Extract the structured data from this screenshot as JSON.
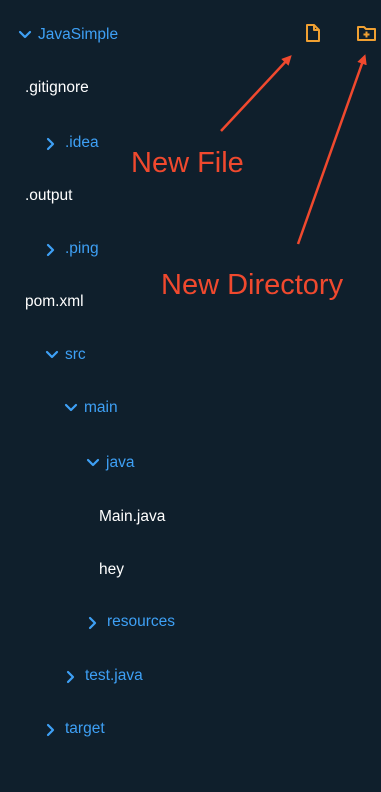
{
  "explorer": {
    "root_label": "JavaSimple",
    "items": [
      {
        "label": ".gitignore"
      },
      {
        "label": ".idea"
      },
      {
        "label": ".output"
      },
      {
        "label": ".ping"
      },
      {
        "label": "pom.xml"
      },
      {
        "label": "src"
      },
      {
        "label": "main"
      },
      {
        "label": "java"
      },
      {
        "label": "Main.java"
      },
      {
        "label": "hey"
      },
      {
        "label": "resources"
      },
      {
        "label": "test.java"
      },
      {
        "label": "target"
      }
    ]
  },
  "toolbar": {
    "new_file_icon": "new-file-icon",
    "new_folder_icon": "new-folder-icon",
    "accent_color": "#f0a032"
  },
  "annotations": {
    "new_file": "New File",
    "new_directory": "New Directory",
    "color": "#f0492e"
  },
  "colors": {
    "background": "#0f1f2c",
    "folder_text": "#3ea0f5",
    "file_text": "#ffffff"
  }
}
